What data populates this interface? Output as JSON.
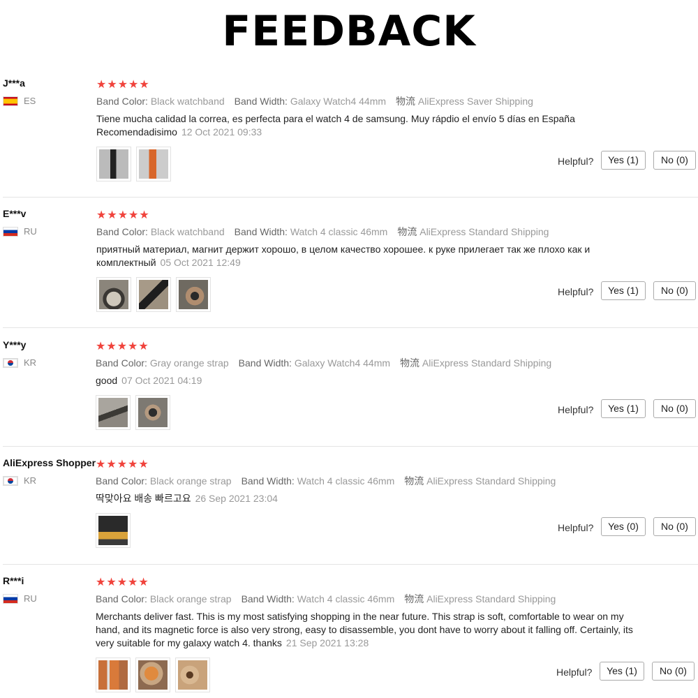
{
  "title": "FEEDBACK",
  "labels": {
    "band_color": "Band Color:",
    "band_width": "Band Width:",
    "shipping_prefix": "物流",
    "helpful": "Helpful?"
  },
  "reviews": [
    {
      "user": "J***a",
      "country": "ES",
      "flag": "es",
      "stars": "★★★★★",
      "band_color": "Black watchband",
      "band_width": "Galaxy Watch4 44mm",
      "shipping": "AliExpress Saver Shipping",
      "comment": "Tiene mucha calidad la correa, es perfecta para el watch 4 de samsung. Muy rápdio el envío 5 días en España Recomendadisimo",
      "date": "12 Oct 2021 09:33",
      "yes": "Yes (1)",
      "no": "No (0)",
      "photo_colors": [
        "#9a9a9a",
        "#d36a2e"
      ]
    },
    {
      "user": "E***v",
      "country": "RU",
      "flag": "ru",
      "stars": "★★★★★",
      "band_color": "Black watchband",
      "band_width": "Watch 4 classic 46mm",
      "shipping": "AliExpress Standard Shipping",
      "comment": "приятный материал, магнит держит хорошо, в целом качество хорошее. к руке прилегает так же плохо как и комплектный",
      "date": "05 Oct 2021 12:49",
      "yes": "Yes (1)",
      "no": "No (0)",
      "photo_colors": [
        "#6a6660",
        "#8a7e70",
        "#7a7468"
      ]
    },
    {
      "user": "Y***y",
      "country": "KR",
      "flag": "kr",
      "stars": "★★★★★",
      "band_color": "Gray orange strap",
      "band_width": "Galaxy Watch4 44mm",
      "shipping": "AliExpress Standard Shipping",
      "comment": "good",
      "date": "07 Oct 2021 04:19",
      "yes": "Yes (1)",
      "no": "No (0)",
      "photo_colors": [
        "#8a8680",
        "#7e7a74"
      ]
    },
    {
      "user": "AliExpress Shopper",
      "country": "KR",
      "flag": "kr",
      "stars": "★★★★★",
      "band_color": "Black orange strap",
      "band_width": "Watch 4 classic 46mm",
      "shipping": "AliExpress Standard Shipping",
      "comment": "딱맞아요 배송 빠르고요",
      "date": "26 Sep 2021 23:04",
      "yes": "Yes (0)",
      "no": "No (0)",
      "photo_colors": [
        "#3a3a3a"
      ]
    },
    {
      "user": "R***i",
      "country": "RU",
      "flag": "ru",
      "stars": "★★★★★",
      "band_color": "Black orange strap",
      "band_width": "Watch 4 classic 46mm",
      "shipping": "AliExpress Standard Shipping",
      "comment": "Merchants deliver fast. This is my most satisfying shopping in the near future. This strap is soft, comfortable to wear on my hand, and its magnetic force is also very strong, easy to disassemble, you dont have to worry about it falling off. Certainly, its very suitable for my galaxy watch 4. thanks",
      "date": "21 Sep 2021 13:28",
      "yes": "Yes (1)",
      "no": "No (0)",
      "photo_colors": [
        "#c9743a",
        "#d9863e",
        "#c8a07a"
      ]
    }
  ]
}
